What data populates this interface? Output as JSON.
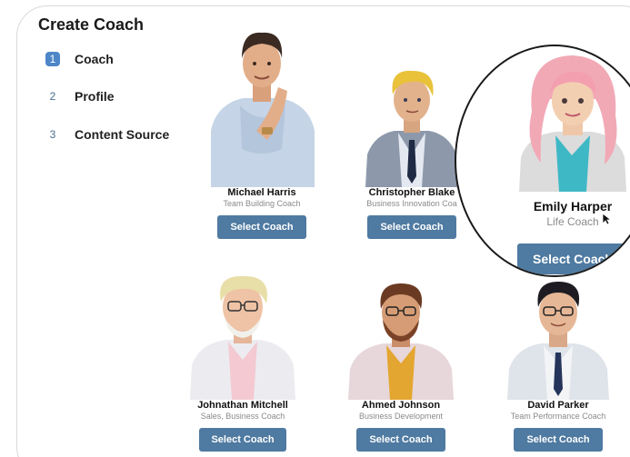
{
  "page": {
    "title": "Create Coach"
  },
  "steps": [
    {
      "number": "1",
      "label": "Coach"
    },
    {
      "number": "2",
      "label": "Profile"
    },
    {
      "number": "3",
      "label": "Content Source"
    }
  ],
  "coaches": [
    {
      "name": "Michael Harris",
      "role": "Team Building Coach",
      "button": "Select Coach"
    },
    {
      "name": "Christopher Blake",
      "role": "Business Innovation Coa",
      "button": "Select Coach"
    },
    {
      "name": "Emily Harper",
      "role": "Life Coach",
      "button": "Select Coach"
    },
    {
      "name": "Johnathan Mitchell",
      "role": "Sales, Business Coach",
      "button": "Select Coach"
    },
    {
      "name": "Ahmed Johnson",
      "role": "Business Development",
      "button": "Select Coach"
    },
    {
      "name": "David Parker",
      "role": "Team Performance Coach",
      "button": "Select Coach"
    }
  ],
  "colors": {
    "accent": "#4f7aa1",
    "active_step": "#4e86c8"
  }
}
